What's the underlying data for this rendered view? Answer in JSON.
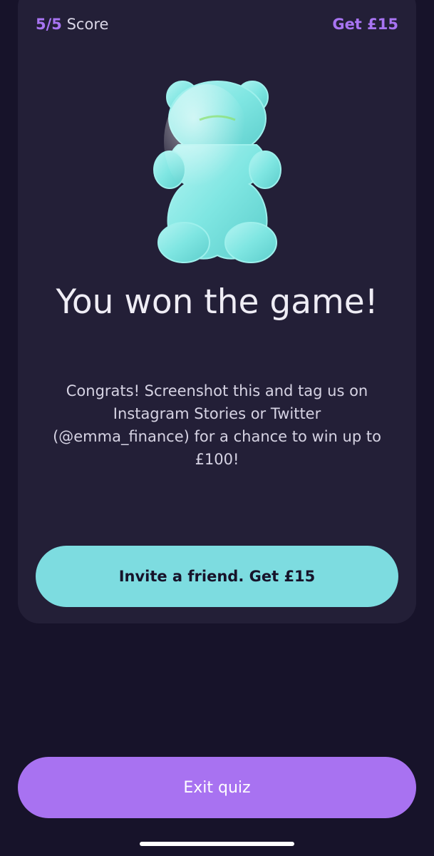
{
  "header": {
    "score_value": "5/5",
    "score_label": "Score",
    "reward_link": "Get £15"
  },
  "hero": {
    "icon": "gummy-bear-icon",
    "headline": "You won the game!",
    "body": "Congrats! Screenshot this and tag us on Instagram Stories or Twitter (@emma_finance) for a chance to win up to £100!"
  },
  "actions": {
    "invite_label": "Invite a friend. Get £15",
    "exit_label": "Exit quiz"
  },
  "colors": {
    "accent_purple": "#a874f2",
    "accent_teal": "#7ddce0",
    "background": "#17132a",
    "card": "#231f37"
  }
}
